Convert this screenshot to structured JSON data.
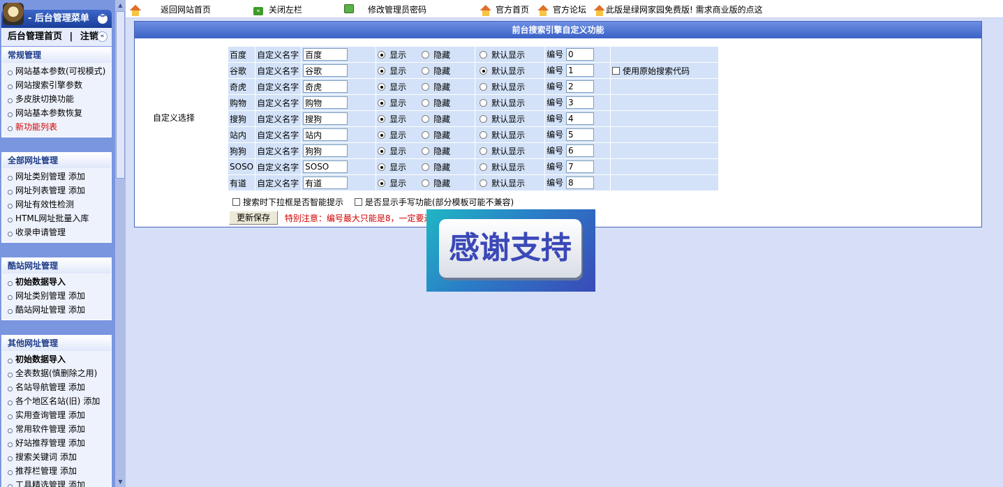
{
  "sidebar": {
    "title": "- 后台管理菜单",
    "home": "后台管理首页",
    "sep": "|",
    "logout": "注销",
    "groups": [
      {
        "title": "常规管理",
        "items": [
          {
            "label": "网站基本参数(可视模式)"
          },
          {
            "label": "网站搜索引擎参数"
          },
          {
            "label": "多皮肤切换功能"
          },
          {
            "label": "网站基本参数恢复"
          },
          {
            "label": "新功能列表"
          }
        ]
      },
      {
        "title": "全部网址管理",
        "items": [
          {
            "label": "网址类别管理",
            "add": "添加"
          },
          {
            "label": "网址列表管理",
            "add": "添加"
          },
          {
            "label": "网址有效性检测"
          },
          {
            "label": "HTML网址批量入库"
          },
          {
            "label": "收录申请管理"
          }
        ]
      },
      {
        "title": "酷站网址管理",
        "items": [
          {
            "label": "初始数据导入"
          },
          {
            "label": "网址类别管理",
            "add": "添加"
          },
          {
            "label": "酷站网址管理",
            "add": "添加"
          }
        ]
      },
      {
        "title": "其他网址管理",
        "items": [
          {
            "label": "初始数据导入"
          },
          {
            "label": "全表数据(慎删除之用)"
          },
          {
            "label": "名站导航管理",
            "add": "添加"
          },
          {
            "label": "各个地区名站(旧)",
            "add": "添加"
          },
          {
            "label": "实用查询管理",
            "add": "添加"
          },
          {
            "label": "常用软件管理",
            "add": "添加"
          },
          {
            "label": "好站推荐管理",
            "add": "添加"
          },
          {
            "label": "搜索关键词",
            "add": "添加"
          },
          {
            "label": "推荐栏管理",
            "add": "添加"
          },
          {
            "label": "工具精选管理",
            "add": "添加"
          }
        ]
      }
    ]
  },
  "topbar": {
    "back_home": "返回网站首页",
    "close_left": "关闭左栏",
    "change_password": "修改管理员密码",
    "official_home": "官方首页",
    "official_forum": "官方论坛",
    "free_notice": "此版是绿网家园免费版! 需求商业版的点这"
  },
  "panel": {
    "title": "前台搜索引擎自定义功能",
    "choose_label": "自定义选择",
    "custom_name_label": "自定义名字",
    "show_label": "显示",
    "hide_label": "隐藏",
    "default_label": "默认显示",
    "number_label": "编号",
    "use_original_label": "使用原始搜索代码",
    "engines": [
      {
        "name": "百度",
        "custom": "百度",
        "show": true,
        "default": false,
        "number": "0"
      },
      {
        "name": "谷歌",
        "custom": "谷歌",
        "show": true,
        "default": true,
        "number": "1"
      },
      {
        "name": "奇虎",
        "custom": "奇虎",
        "show": true,
        "default": false,
        "number": "2"
      },
      {
        "name": "购物",
        "custom": "购物",
        "show": true,
        "default": false,
        "number": "3"
      },
      {
        "name": "搜狗",
        "custom": "搜狗",
        "show": true,
        "default": false,
        "number": "4"
      },
      {
        "name": "站内",
        "custom": "站内",
        "show": true,
        "default": false,
        "number": "5"
      },
      {
        "name": "狗狗",
        "custom": "狗狗",
        "show": true,
        "default": false,
        "number": "6"
      },
      {
        "name": "SOSO",
        "custom": "SOSO",
        "show": true,
        "default": false,
        "number": "7"
      },
      {
        "name": "有道",
        "custom": "有道",
        "show": true,
        "default": false,
        "number": "8"
      }
    ],
    "smart_hint_label": "搜索时下拉框是否智能提示",
    "handwrite_label": "是否显示手写功能(部分模板可能不兼容)",
    "save_label": "更新保存",
    "note": "特别注意：编号最大只能是8，一定要连"
  },
  "banner": {
    "text": "感谢支持"
  }
}
